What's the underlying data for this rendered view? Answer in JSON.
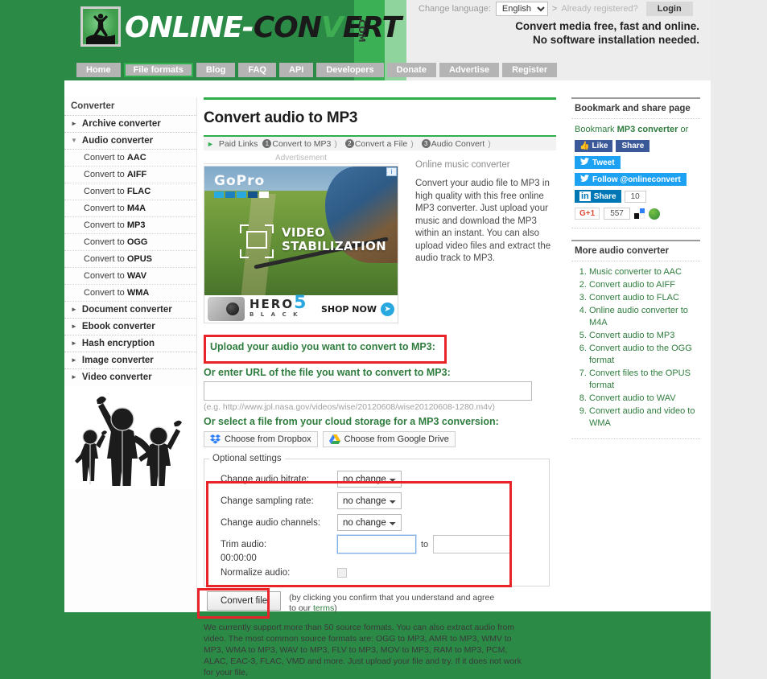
{
  "header": {
    "logo_online": "ONLINE-",
    "logo_con": "CON",
    "logo_v": "V",
    "logo_ert": "ERT",
    "logo_com": ".COM",
    "change_language_label": "Change language:",
    "language_value": "English",
    "arrow": ">",
    "already_registered": "Already registered?",
    "login_label": "Login",
    "tagline_line1": "Convert media free, fast and online.",
    "tagline_line2": "No software installation needed."
  },
  "nav": {
    "items": [
      {
        "label": "Home",
        "active": false
      },
      {
        "label": "File formats",
        "active": true
      },
      {
        "label": "Blog",
        "active": false
      },
      {
        "label": "FAQ",
        "active": false
      },
      {
        "label": "API",
        "active": false
      },
      {
        "label": "Developers",
        "active": false
      },
      {
        "label": "Donate",
        "active": false
      },
      {
        "label": "Advertise",
        "active": false
      },
      {
        "label": "Register",
        "active": false
      }
    ]
  },
  "sidebar": {
    "title": "Converter",
    "groups": [
      {
        "label": "Archive converter",
        "expanded": false
      },
      {
        "label": "Audio converter",
        "expanded": true
      }
    ],
    "audio_items": [
      {
        "prefix": "Convert to ",
        "format": "AAC"
      },
      {
        "prefix": "Convert to ",
        "format": "AIFF"
      },
      {
        "prefix": "Convert to ",
        "format": "FLAC"
      },
      {
        "prefix": "Convert to ",
        "format": "M4A"
      },
      {
        "prefix": "Convert to ",
        "format": "MP3"
      },
      {
        "prefix": "Convert to ",
        "format": "OGG"
      },
      {
        "prefix": "Convert to ",
        "format": "OPUS"
      },
      {
        "prefix": "Convert to ",
        "format": "WAV"
      },
      {
        "prefix": "Convert to ",
        "format": "WMA"
      }
    ],
    "groups_after": [
      {
        "label": "Document converter"
      },
      {
        "label": "Ebook converter"
      },
      {
        "label": "Hash encryption"
      },
      {
        "label": "Image converter"
      },
      {
        "label": "Video converter"
      }
    ]
  },
  "main": {
    "page_title": "Convert audio to MP3",
    "paid_links_label": "Paid Links",
    "paid_links": [
      {
        "num": "1",
        "label": "Convert to MP3"
      },
      {
        "num": "2",
        "label": "Convert a File"
      },
      {
        "num": "3",
        "label": "Audio Convert"
      }
    ],
    "advertisement_label": "Advertisement",
    "ad": {
      "brand": "GoPro",
      "headline_line1": "VIDEO",
      "headline_line2": "STABILIZATION",
      "product": "HERO",
      "product_number": "5",
      "product_sub": "B L A C K",
      "cta": "SHOP NOW",
      "adchoice": "i"
    },
    "ad_desc": {
      "heading": "Online music converter",
      "body": "Convert your audio file to MP3 in high quality with this free online MP3 converter. Just upload your music and download the MP3 within an instant. You can also upload video files and extract the audio track to MP3."
    },
    "upload_label": "Upload your audio you want to convert to MP3:",
    "url_label": "Or enter URL of the file you want to convert to MP3:",
    "url_value": "",
    "url_hint": "(e.g. http://www.jpl.nasa.gov/videos/wise/20120608/wise20120608-1280.m4v)",
    "cloud_label": "Or select a file from your cloud storage for a MP3 conversion:",
    "dropbox_label": "Choose from Dropbox",
    "gdrive_label": "Choose from Google Drive",
    "optional_legend": "Optional settings",
    "settings": [
      {
        "label": "Change audio bitrate:",
        "value": "no change"
      },
      {
        "label": "Change sampling rate:",
        "value": "no change"
      },
      {
        "label": "Change audio channels:",
        "value": "no change"
      }
    ],
    "trim_label": "Trim audio:",
    "trim_from": "",
    "trim_to_word": "to",
    "trim_to": "",
    "timecode": "00:00:00",
    "normalize_label": "Normalize audio:",
    "convert_button": "Convert file",
    "terms_line1": "(by clicking you confirm that you understand and agree",
    "terms_line2_pre": "to our ",
    "terms_link": "terms",
    "terms_line2_post": ")",
    "bottom_copy": "We currently support more than 50 source formats. You can also extract audio from video. The most common source formats are: OGG to MP3, AMR to MP3, WMV to MP3, WMA to MP3, WAV to MP3, FLV to MP3, MOV to MP3, RAM to MP3, PCM, ALAC, EAC-3, FLAC, VMD and more. Just upload your file and try. If it does not work for your file,"
  },
  "right_sidebar": {
    "bookmark_card": {
      "title": "Bookmark and share page",
      "line_pre": "Bookmark ",
      "line_bold": "MP3 converter",
      "line_post": " or",
      "fb_like": "Like",
      "fb_share": "Share",
      "tweet": "Tweet",
      "follow": "Follow @onlineconvert",
      "linkedin_in": "in",
      "linkedin_share": "Share",
      "linkedin_count": "10",
      "gplus": "G+1",
      "gplus_count": "557"
    },
    "more_card": {
      "title": "More audio converter",
      "items": [
        "Music converter to AAC",
        "Convert audio to AIFF",
        "Convert audio to FLAC",
        "Online audio converter to M4A",
        "Convert audio to MP3",
        "Convert audio to the OGG format",
        "Convert files to the OPUS format",
        "Convert audio to WAV",
        "Convert audio and video to WMA"
      ]
    }
  },
  "colors": {
    "brand_green": "#2a8a46",
    "accent_green": "#2fae4e",
    "highlight_red": "#e8232a",
    "link_green": "#2f7d3e"
  }
}
